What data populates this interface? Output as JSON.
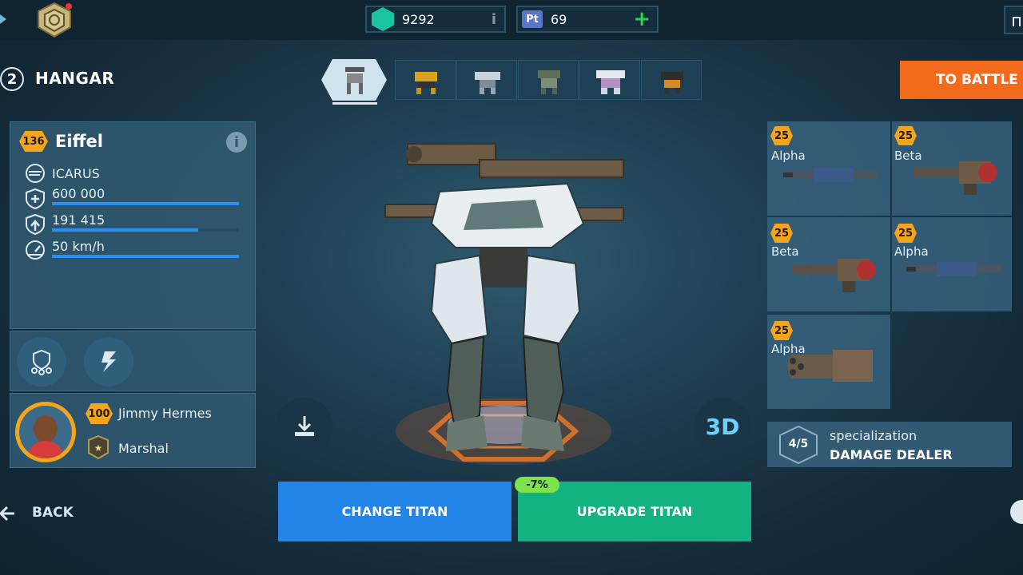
{
  "currency": {
    "gems": "9292",
    "platinum_icon_label": "Pt",
    "platinum": "69"
  },
  "header": {
    "step_number": "2",
    "title": "HANGAR",
    "battle_label": "TO BATTLE"
  },
  "robot": {
    "level": "136",
    "name": "Eiffel",
    "class": "ICARUS",
    "durability": "600 000",
    "durability_fill": 1.0,
    "armor": "191 415",
    "armor_fill": 0.78,
    "speed": "50 km/h",
    "speed_fill": 1.0
  },
  "pilot": {
    "level": "100",
    "name": "Jimmy Hermes",
    "rank": "Marshal"
  },
  "weapons": [
    {
      "level": "25",
      "name": "Alpha"
    },
    {
      "level": "25",
      "name": "Beta"
    },
    {
      "level": "25",
      "name": "Beta"
    },
    {
      "level": "25",
      "name": "Alpha"
    },
    {
      "level": "25",
      "name": "Alpha"
    }
  ],
  "specialization": {
    "label": "specialization",
    "value": "DAMAGE DEALER",
    "progress": "4/5"
  },
  "view_3d_label": "3D",
  "buttons": {
    "change": "CHANGE TITAN",
    "upgrade": "UPGRADE TITAN",
    "discount": "-7%",
    "back": "BACK"
  },
  "colors": {
    "accent_orange": "#f26b1d",
    "change_blue": "#2385e8",
    "upgrade_green": "#12b381",
    "level_gold": "#f4a51c"
  }
}
